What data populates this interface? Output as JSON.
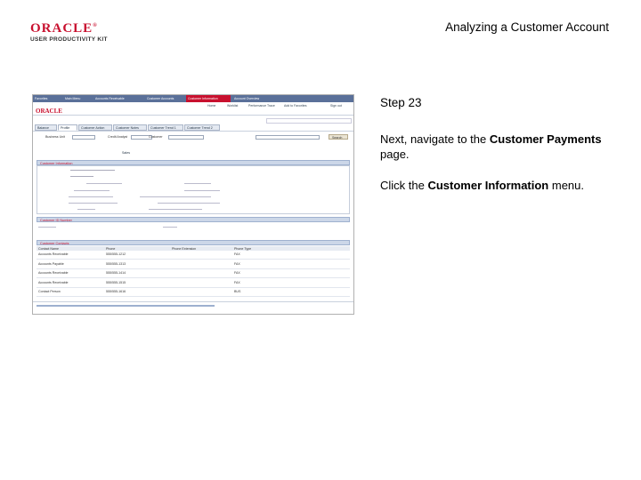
{
  "header": {
    "logo_word": "ORACLE",
    "logo_sub": "USER PRODUCTIVITY KIT",
    "title": "Analyzing a Customer Account"
  },
  "screenshot": {
    "topbar_items": [
      "Favorites",
      "Main Menu",
      "Accounts Receivable",
      "Customer Accounts",
      "Customer Information",
      "Account Overview"
    ],
    "nav_links": [
      "Home",
      "Worklist",
      "Performance Trace",
      "Add to Favorites",
      "Sign out"
    ],
    "logo": "ORACLE",
    "tabs": [
      "Balance",
      "Profile",
      "Customer Action",
      "Customer Notes",
      "Customer Trend 1",
      "Customer Trend 2"
    ],
    "fields": {
      "business_unit": "Business Unit",
      "credit_analyst": "Credit Analyst",
      "customer": "Customer",
      "sales": "Sales",
      "search": "Search"
    },
    "sections": {
      "customer_info": "Customer Information",
      "customer_id": "Customer ID Number",
      "customer_contacts": "Customer Contacts"
    },
    "contacts_headers": [
      "Contact Name",
      "Phone",
      "Phone Extension",
      "Phone Type"
    ],
    "contacts_rows": [
      [
        "Accounts Receivable",
        "555/555-1212",
        "",
        "FAX"
      ],
      [
        "Accounts Payable",
        "555/555-1313",
        "",
        "FAX"
      ],
      [
        "Accounts Receivable",
        "555/555-1414",
        "",
        "FAX"
      ],
      [
        "Accounts Receivable",
        "555/555-1515",
        "",
        "FAX"
      ],
      [
        "Contact Person",
        "555/555-1616",
        "",
        "BUS"
      ]
    ]
  },
  "instructions": {
    "step": "Step 23",
    "line1_pre": "Next, navigate to the ",
    "line1_bold": "Customer Payments",
    "line1_post": " page.",
    "line2_pre": "Click the ",
    "line2_bold": "Customer Information",
    "line2_post": " menu."
  }
}
